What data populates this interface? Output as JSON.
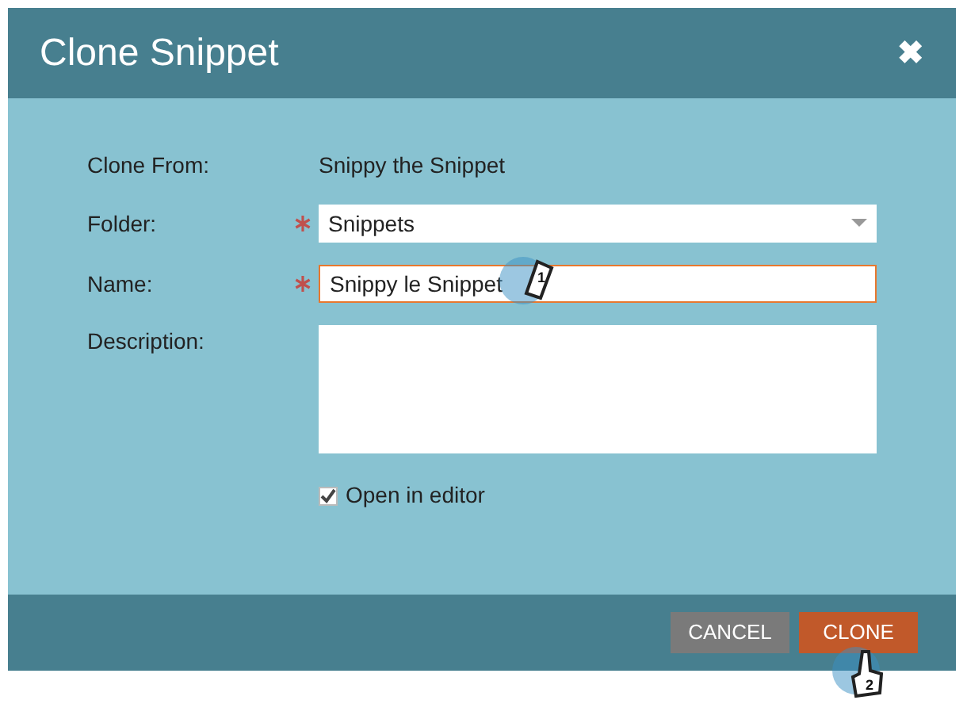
{
  "dialog": {
    "title": "Clone Snippet",
    "close": "✖"
  },
  "form": {
    "clone_from": {
      "label": "Clone From:",
      "value": "Snippy the Snippet"
    },
    "folder": {
      "label": "Folder:",
      "required": true,
      "value": "Snippets"
    },
    "name": {
      "label": "Name:",
      "required": true,
      "value": "Snippy le Snippet",
      "focused": true
    },
    "description": {
      "label": "Description:"
    },
    "open_in_editor": {
      "label": "Open in editor",
      "checked": true
    }
  },
  "buttons": [
    {
      "label": "CANCEL",
      "kind": "secondary"
    },
    {
      "label": "CLONE",
      "kind": "primary"
    }
  ],
  "annotations": [
    {
      "kind": "pencil",
      "label": "1"
    },
    {
      "kind": "pointer",
      "label": "2"
    }
  ]
}
